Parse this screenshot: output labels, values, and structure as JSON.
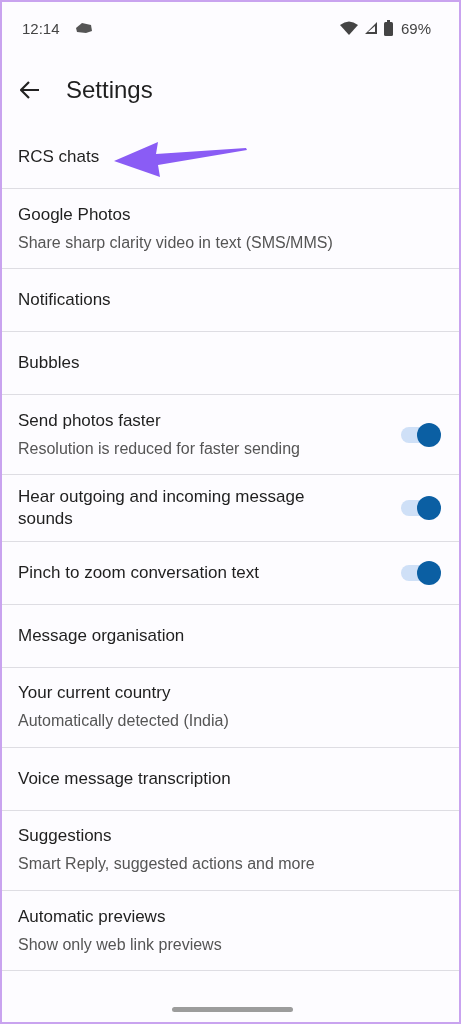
{
  "status_bar": {
    "time": "12:14",
    "battery": "69%"
  },
  "header": {
    "title": "Settings"
  },
  "items": [
    {
      "kind": "link",
      "title": "RCS chats"
    },
    {
      "kind": "link",
      "title": "Google Photos",
      "subtitle": "Share sharp clarity video in text (SMS/MMS)"
    },
    {
      "kind": "link",
      "title": "Notifications"
    },
    {
      "kind": "link",
      "title": "Bubbles"
    },
    {
      "kind": "switch",
      "title": "Send photos faster",
      "subtitle": "Resolution is reduced for faster sending",
      "on": true
    },
    {
      "kind": "switch",
      "title": "Hear outgoing and incoming message sounds",
      "on": true
    },
    {
      "kind": "switch",
      "title": "Pinch to zoom conversation text",
      "on": true
    },
    {
      "kind": "link",
      "title": "Message organisation"
    },
    {
      "kind": "link",
      "title": "Your current country",
      "subtitle": "Automatically detected (India)"
    },
    {
      "kind": "link",
      "title": "Voice message transcription"
    },
    {
      "kind": "link",
      "title": "Suggestions",
      "subtitle": "Smart Reply, suggested actions and more"
    },
    {
      "kind": "link",
      "title": "Automatic previews",
      "subtitle": "Show only web link previews"
    }
  ]
}
